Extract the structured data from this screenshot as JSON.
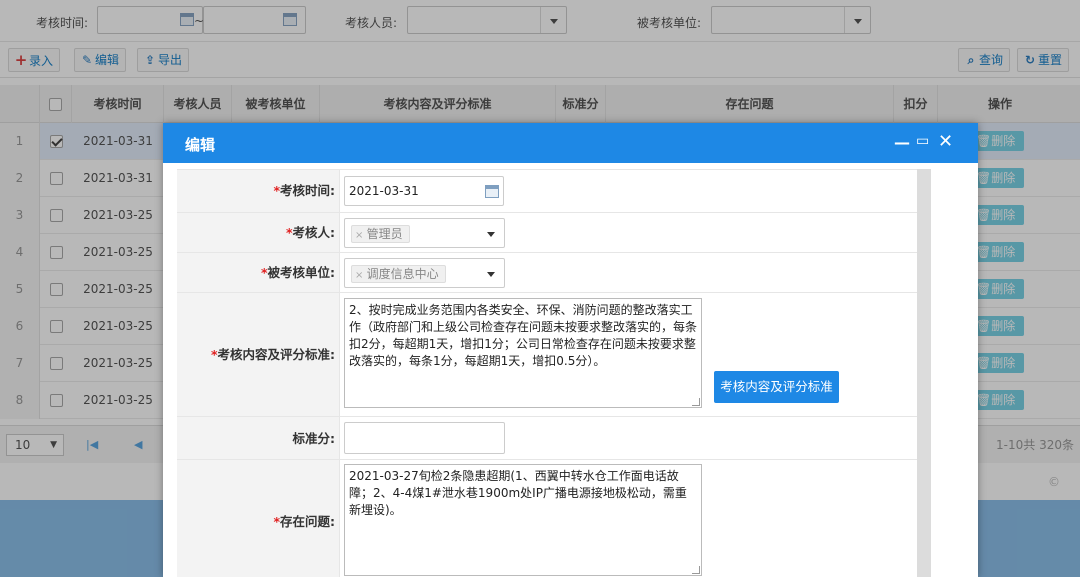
{
  "filters": {
    "time_label": "考核时间:",
    "tilde": "~",
    "person_label": "考核人员:",
    "unit_label": "被考核单位:"
  },
  "toolbar": {
    "add_label": "录入",
    "edit_label": "编辑",
    "export_label": "导出",
    "query_label": "查询",
    "reset_label": "重置"
  },
  "grid": {
    "columns": [
      "考核时间",
      "考核人员",
      "被考核单位",
      "考核内容及评分标准",
      "标准分",
      "存在问题",
      "扣分",
      "操作"
    ],
    "rows": [
      {
        "num": "1",
        "date": "2021-03-31",
        "checked": true
      },
      {
        "num": "2",
        "date": "2021-03-31",
        "checked": false
      },
      {
        "num": "3",
        "date": "2021-03-25",
        "checked": false
      },
      {
        "num": "4",
        "date": "2021-03-25",
        "checked": false
      },
      {
        "num": "5",
        "date": "2021-03-25",
        "checked": false
      },
      {
        "num": "6",
        "date": "2021-03-25",
        "checked": false
      },
      {
        "num": "7",
        "date": "2021-03-25",
        "checked": false
      },
      {
        "num": "8",
        "date": "2021-03-25",
        "checked": false
      }
    ],
    "delete_label": "删除"
  },
  "pager": {
    "page_size": "10",
    "info": "1-10共 320条"
  },
  "copyright": "©",
  "modal": {
    "title": "编辑",
    "fields": {
      "time_label": "考核时间:",
      "time_value": "2021-03-31",
      "person_label": "考核人:",
      "person_tag": "管理员",
      "unit_label": "被考核单位:",
      "unit_tag": "调度信息中心",
      "content_label": "考核内容及评分标准:",
      "content_value": "2、按时完成业务范围内各类安全、环保、消防问题的整改落实工作（政府部门和上级公司检查存在问题未按要求整改落实的，每条扣2分，每超期1天，增扣1分；公司日常检查存在问题未按要求整改落实的，每条1分，每超期1天，增扣0.5分）。",
      "content_button": "考核内容及评分标准",
      "score_label": "标准分:",
      "score_value": "",
      "issue_label": "存在问题:",
      "issue_value": "2021-03-27旬检2条隐患超期(1、西翼中转水仓工作面电话故障；2、4-4煤1#泄水巷1900m处IP广播电源接地极松动，需重新埋设)。"
    }
  }
}
